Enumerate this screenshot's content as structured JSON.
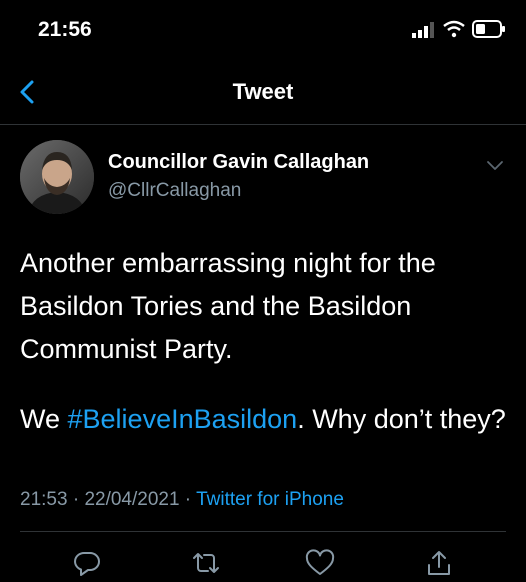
{
  "status_bar": {
    "time": "21:56",
    "icons": [
      "signal-icon",
      "wifi-icon",
      "battery-icon"
    ]
  },
  "nav": {
    "title": "Tweet",
    "back_icon": "chevron-left-icon"
  },
  "tweet": {
    "author": {
      "name": "Councillor Gavin Callaghan",
      "handle": "@CllrCallaghan"
    },
    "text": {
      "para1": "Another embarrassing night for the Basildon Tories and the Basildon Communist Party.",
      "para2_prefix": "We ",
      "hashtag": "#BelieveInBasildon",
      "para2_suffix": ". Why don’t they?"
    },
    "meta": {
      "time": "21:53",
      "sep1": " · ",
      "date": "22/04/2021",
      "sep2": " · ",
      "source": "Twitter for iPhone"
    },
    "actions": [
      "reply-icon",
      "retweet-icon",
      "like-icon",
      "share-icon"
    ]
  },
  "colors": {
    "background": "#000000",
    "text": "#ffffff",
    "secondary_text": "#8899a6",
    "accent": "#1da1f2",
    "divider": "#2f3336"
  }
}
